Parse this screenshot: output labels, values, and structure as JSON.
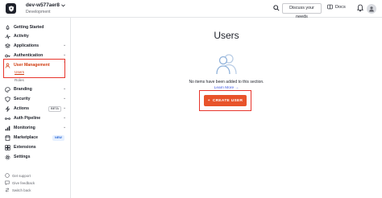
{
  "header": {
    "tenant_name": "dev-w577aer8",
    "tenant_env": "Development",
    "discuss_label": "Discuss your needs",
    "docs_label": "Docs"
  },
  "sidebar": {
    "items": [
      {
        "label": "Getting Started",
        "icon": "rocket-icon"
      },
      {
        "label": "Activity",
        "icon": "activity-icon"
      },
      {
        "label": "Applications",
        "icon": "layers-icon"
      },
      {
        "label": "Authentication",
        "icon": "key-icon"
      },
      {
        "label": "User Management",
        "icon": "user-icon"
      },
      {
        "label": "Branding",
        "icon": "palette-icon"
      },
      {
        "label": "Security",
        "icon": "shield-icon"
      },
      {
        "label": "Actions",
        "icon": "bolt-icon",
        "badge": "BETA"
      },
      {
        "label": "Auth Pipeline",
        "icon": "pipeline-icon"
      },
      {
        "label": "Monitoring",
        "icon": "monitoring-icon"
      },
      {
        "label": "Marketplace",
        "icon": "store-icon",
        "badge": "NEW"
      },
      {
        "label": "Extensions",
        "icon": "extensions-icon"
      },
      {
        "label": "Settings",
        "icon": "gear-icon"
      }
    ],
    "subitems": {
      "users": "Users",
      "roles": "Roles"
    },
    "footer": {
      "support": "Get support",
      "feedback": "Give feedback",
      "switch": "Switch back"
    }
  },
  "main": {
    "title": "Users",
    "empty_message": "No items have been added to this section.",
    "learn_more": "Learn More →",
    "create_button": "CREATE USER",
    "create_button_prefix": "+"
  },
  "colors": {
    "accent": "#e8532a",
    "active": "#d03c10",
    "highlight": "#e8352c",
    "link": "#3f59e4"
  }
}
